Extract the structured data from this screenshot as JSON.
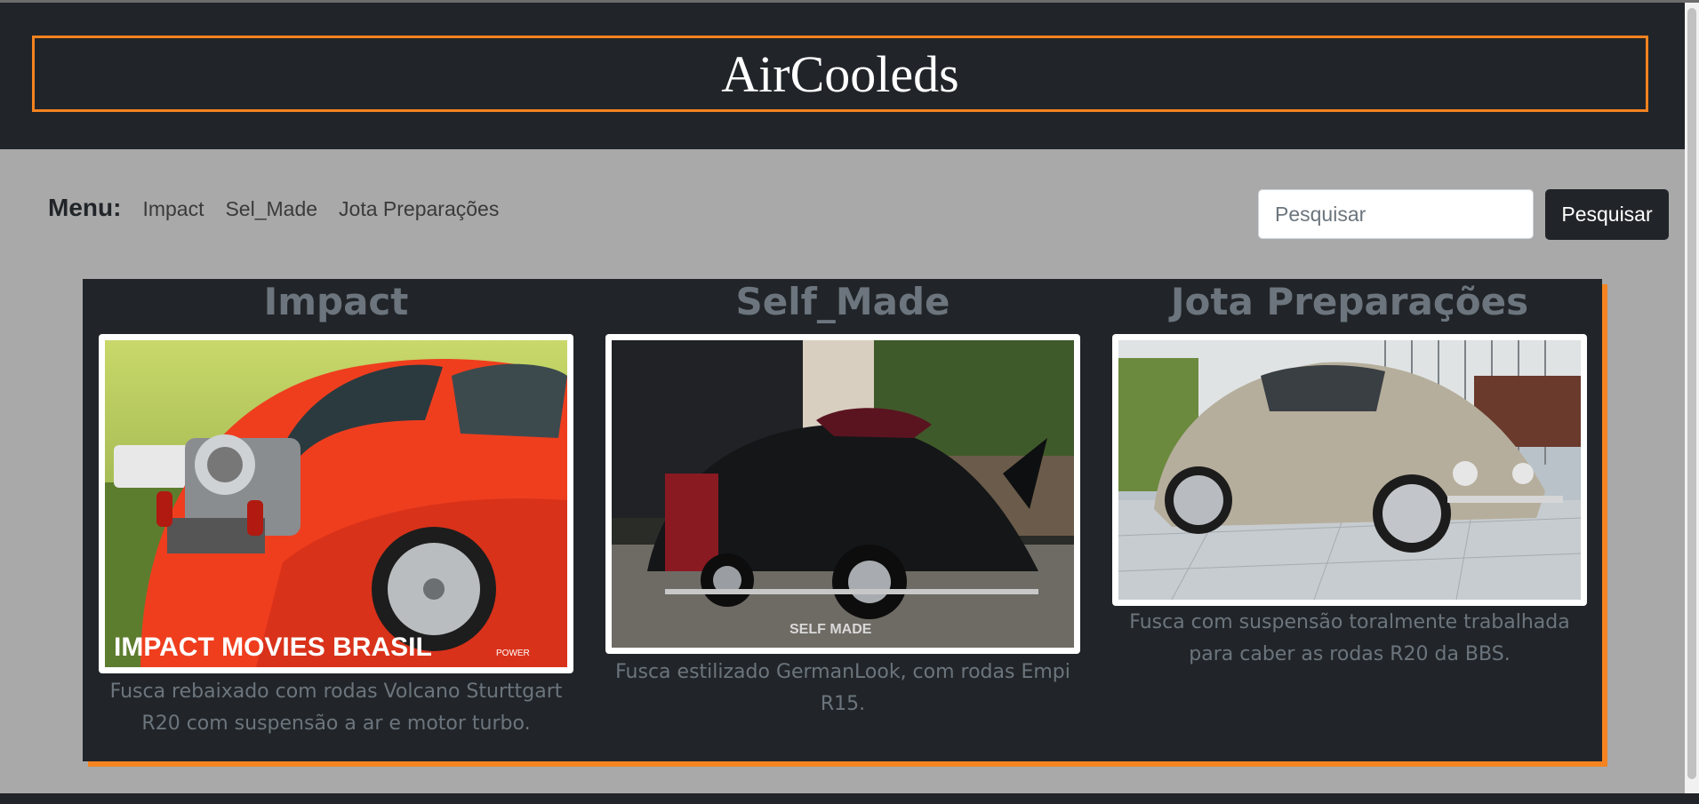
{
  "header": {
    "title": "AirCooleds"
  },
  "nav": {
    "menu_label": "Menu:",
    "links": [
      "Impact",
      "Sel_Made",
      "Jota Preparações"
    ]
  },
  "search": {
    "placeholder": "Pesquisar",
    "button_label": "Pesquisar"
  },
  "cards": [
    {
      "title": "Impact",
      "description": "Fusca rebaixado com rodas Volcano Sturttgart R20 com suspensão a ar e motor turbo.",
      "image": "orange beetle with exposed turbo engine",
      "watermark": "IMPACT MOVIES BRASIL"
    },
    {
      "title": "Self_Made",
      "description": "Fusca estilizado GermanLook, com rodas Empi R15.",
      "image": "black beetle with open doors in garage",
      "watermark": "SELF MADE"
    },
    {
      "title": "Jota Preparações",
      "description": "Fusca com suspensão toralmente trabalhada para caber as rodas R20 da BBS.",
      "image": "beige lowered beetle on tiled driveway"
    }
  ],
  "colors": {
    "accent": "#f5831f",
    "dark": "#212529",
    "background": "#a9a9a9"
  }
}
